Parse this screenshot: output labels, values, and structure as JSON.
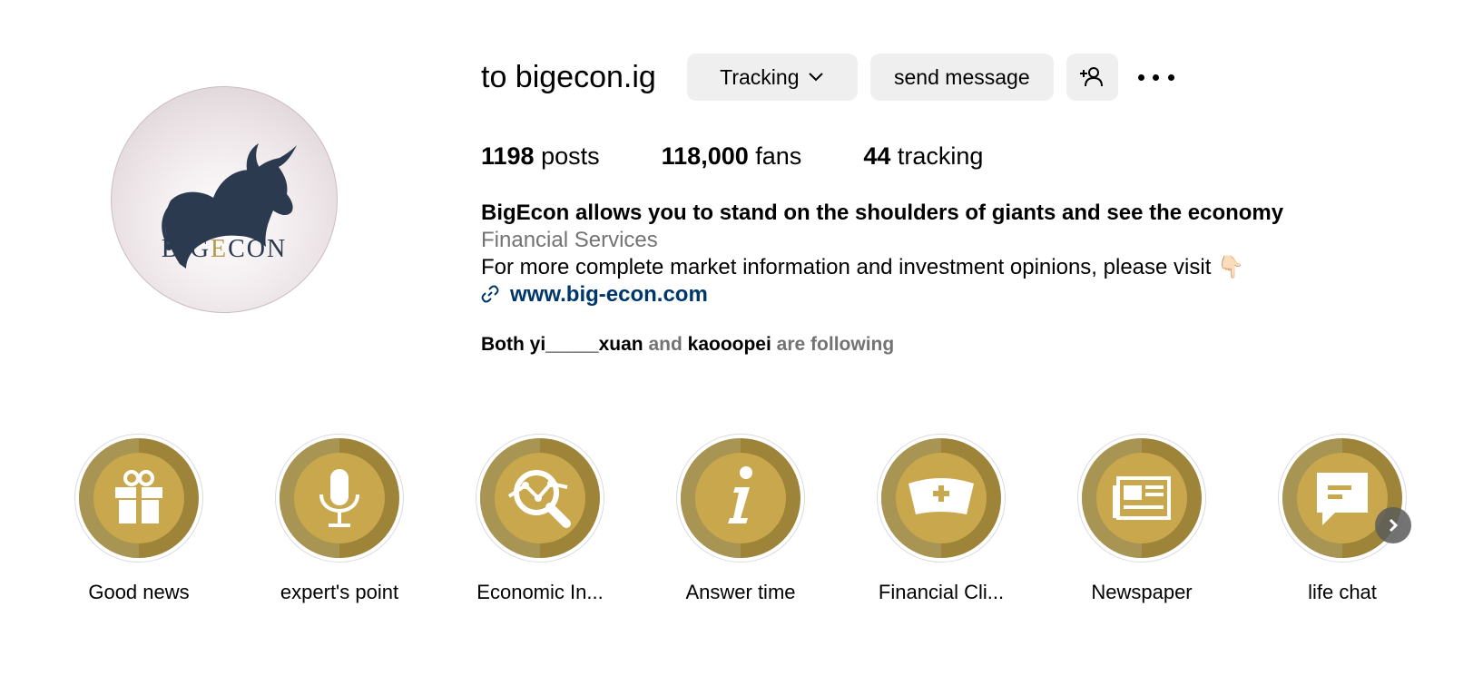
{
  "profile": {
    "username": "to bigecon.ig",
    "avatar_brand_left": "BIG",
    "avatar_brand_mid": "E",
    "avatar_brand_right": "CON"
  },
  "actions": {
    "tracking_label": "Tracking",
    "message_label": "send message"
  },
  "stats": {
    "posts_count": "1198",
    "posts_label": "posts",
    "fans_count": "118,000",
    "fans_label": "fans",
    "tracking_count": "44",
    "tracking_label": "tracking"
  },
  "bio": {
    "name": "BigEcon allows you to stand on the shoulders of giants and see the economy",
    "category": "Financial Services",
    "text": "For more complete market information and investment opinions, please visit 👇🏻",
    "link": "www.big-econ.com"
  },
  "followed_by": {
    "prefix": "Both",
    "user1": "yi_____xuan",
    "and": "and",
    "user2": "kaooopei",
    "suffix": "are following"
  },
  "highlights": [
    {
      "label": "Good news",
      "icon": "gift-icon"
    },
    {
      "label": "expert's point",
      "icon": "microphone-icon"
    },
    {
      "label": "Economic In...",
      "icon": "magnifier-chart-icon"
    },
    {
      "label": "Answer time",
      "icon": "info-icon"
    },
    {
      "label": "Financial Cli...",
      "icon": "nurse-cap-icon"
    },
    {
      "label": "Newspaper",
      "icon": "newspaper-icon"
    },
    {
      "label": "life chat",
      "icon": "chat-bubble-icon"
    }
  ],
  "colors": {
    "highlight_gold": "#c9a74d",
    "highlight_gold_dark": "#9d8439",
    "link_blue": "#00376b",
    "muted_gray": "#737373",
    "button_gray": "#efefef"
  }
}
